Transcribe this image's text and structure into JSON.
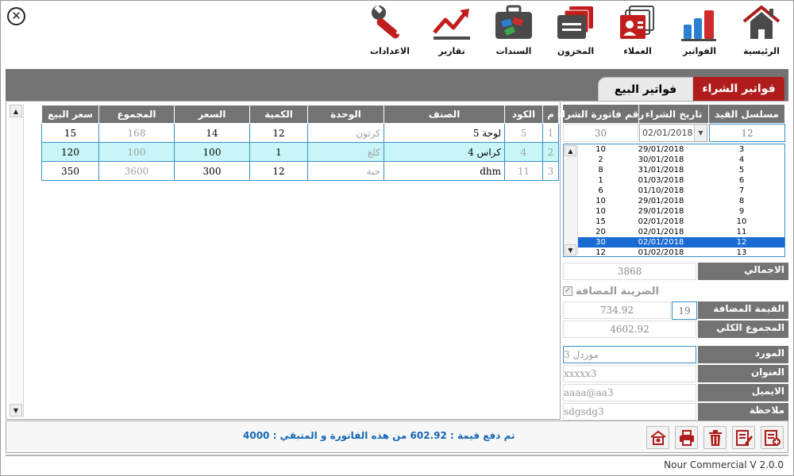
{
  "toolbar": {
    "home_label": "الرئيسية",
    "invoices_label": "الفواتير",
    "clients_label": "العملاء",
    "inventory_label": "المخزون",
    "vouchers_label": "السندات",
    "reports_label": "تقارير",
    "settings_label": "الاعدادات"
  },
  "tabs": {
    "purchase": "فواتير الشراء",
    "sales": "فواتير البيع"
  },
  "grid": {
    "headers": {
      "num": "م",
      "code": "الكود",
      "item": "الصنف",
      "unit": "الوحدة",
      "qty": "الكمية",
      "price": "السعر",
      "total": "المجموع",
      "sell_price": "سعر البيع"
    },
    "rows": [
      {
        "num": "1",
        "code": "5",
        "item": "لوحة 5",
        "unit": "كرتون",
        "qty": "12",
        "price": "14",
        "total": "168",
        "sell_price": "15"
      },
      {
        "num": "2",
        "code": "4",
        "item": "كراس 4",
        "unit": "كلغ",
        "qty": "1",
        "price": "100",
        "total": "100",
        "sell_price": "120"
      },
      {
        "num": "3",
        "code": "11",
        "item": "dhm",
        "unit": "حبة",
        "qty": "12",
        "price": "300",
        "total": "3600",
        "sell_price": "350"
      }
    ]
  },
  "invoice_header": {
    "serial_label": "مسلسل القيد",
    "date_label": "تاريخ الشراء",
    "invoice_no_label": "رقم فاتورة الشراء",
    "serial_value": "12",
    "date_value": "02/01/2018",
    "invoice_no_value": "30"
  },
  "invoice_list": [
    {
      "inv": "10",
      "date": "29/01/2018",
      "serial": "3"
    },
    {
      "inv": "2",
      "date": "30/01/2018",
      "serial": "4"
    },
    {
      "inv": "8",
      "date": "31/01/2018",
      "serial": "5"
    },
    {
      "inv": "1",
      "date": "01/03/2018",
      "serial": "6"
    },
    {
      "inv": "6",
      "date": "01/10/2018",
      "serial": "7"
    },
    {
      "inv": "10",
      "date": "29/01/2018",
      "serial": "8"
    },
    {
      "inv": "10",
      "date": "29/01/2018",
      "serial": "9"
    },
    {
      "inv": "15",
      "date": "02/01/2018",
      "serial": "10"
    },
    {
      "inv": "20",
      "date": "02/01/2018",
      "serial": "11"
    },
    {
      "inv": "30",
      "date": "02/01/2018",
      "serial": "12"
    },
    {
      "inv": "12",
      "date": "01/02/2018",
      "serial": "13"
    }
  ],
  "totals": {
    "total_label": "الاجمالي",
    "total_value": "3868",
    "vat_check_label": "الضريبة المضافة",
    "vat_amount_label": "القيمة المضافة",
    "vat_rate": "19",
    "vat_amount": "734.92",
    "grand_total_label": "المجموع الكلي",
    "grand_total": "4602.92"
  },
  "supplier": {
    "supplier_label": "المورد",
    "supplier_value": "موردل 3",
    "address_label": "العنوان",
    "address_value": "xxxxx3",
    "email_label": "الايميل",
    "email_value": "aaaa@aa3",
    "note_label": "ملاحظة",
    "note_value": "sdgsdg3"
  },
  "status": {
    "message": "تم دفع قيمة : 602.92 من هذه الفاتورة و المتبقي : 4000"
  },
  "footer": {
    "version": "Nour Commercial V 2.0.0"
  },
  "colors": {
    "header_gray": "#737373",
    "accent_red": "#b01b1b",
    "grid_border": "#3b8fc9",
    "selected_row": "#c8f6f8",
    "list_selection": "#1a6ad4",
    "status_blue": "#1466b4"
  }
}
